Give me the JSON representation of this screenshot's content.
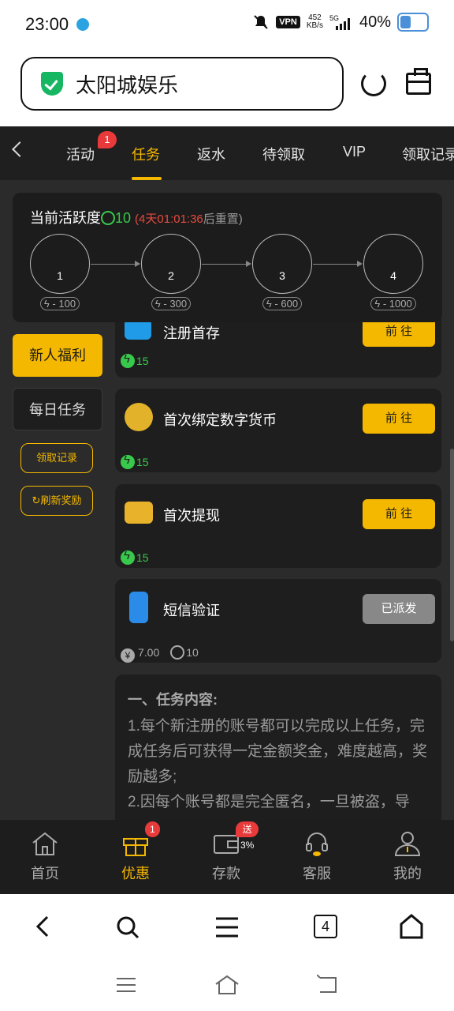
{
  "status": {
    "time": "23:00",
    "vpn": "VPN",
    "speed_value": "452",
    "speed_unit": "KB/s",
    "network": "5G",
    "battery": "40%"
  },
  "browser": {
    "url_text": "太阳城娱乐",
    "tab_count": "4"
  },
  "tabs": {
    "items": [
      "活动",
      "任务",
      "返水",
      "待领取",
      "VIP",
      "领取记录"
    ],
    "active_index": 1,
    "badge": "1"
  },
  "activity": {
    "label": "当前活跃度",
    "value": "10",
    "paren_open": "(",
    "timer": "4天01:01:36",
    "reset_text": "后重置)",
    "nodes": [
      {
        "num": "1",
        "cost": "- 100"
      },
      {
        "num": "2",
        "cost": "- 300"
      },
      {
        "num": "3",
        "cost": "- 600"
      },
      {
        "num": "4",
        "cost": "- 1000"
      }
    ]
  },
  "menu": {
    "newbie": "新人福利",
    "daily": "每日任务",
    "records": "领取记录",
    "refresh": "刷新奖励"
  },
  "tasks": [
    {
      "title": "注册首存",
      "button": "前 往",
      "reward": "15",
      "state": "go"
    },
    {
      "title": "首次绑定数字货币",
      "button": "前 往",
      "reward": "15",
      "state": "go"
    },
    {
      "title": "首次提现",
      "button": "前 往",
      "reward": "15",
      "state": "go"
    },
    {
      "title": "短信验证",
      "button": "已派发",
      "reward_money": "7.00",
      "reward": "10",
      "state": "done"
    }
  ],
  "info": {
    "heading": "一、任务内容:",
    "line1": "1.每个新注册的账号都可以完成以上任务，完成任务后可获得一定金额奖金，难度越高，奖励越多;",
    "line2": "2.因每个账号都是完全匿名，一旦被盗，导"
  },
  "appnav": {
    "items": [
      "首页",
      "优惠",
      "存款",
      "客服",
      "我的"
    ],
    "active_index": 1,
    "promo_badge": "1",
    "deposit_badge": "送3%"
  },
  "colors": {
    "accent": "#f5b800",
    "green": "#38c94c",
    "red": "#e83a3a",
    "bg": "#2b2b2b"
  }
}
